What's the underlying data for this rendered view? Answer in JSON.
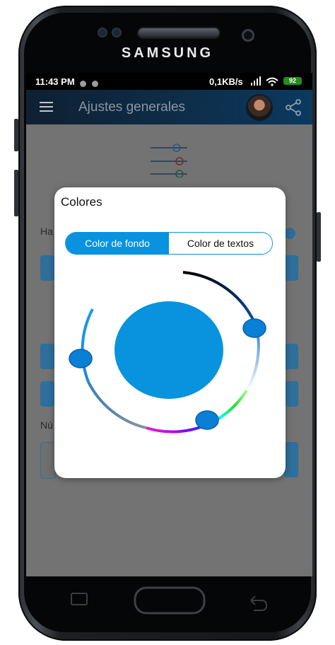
{
  "device": {
    "brand": "SAMSUNG"
  },
  "statusbar": {
    "time": "11:43 PM",
    "network_rate": "0,1KB/s",
    "battery": "92"
  },
  "appbar": {
    "title": "Ajustes generales",
    "menu_icon": "hamburger-menu-icon",
    "share_icon": "share-icon"
  },
  "background": {
    "label_a": "Ha",
    "label_b": "Nú"
  },
  "dialog": {
    "title": "Colores",
    "tabs": [
      {
        "label": "Color de fondo",
        "active": true
      },
      {
        "label": "Color de textos",
        "active": false
      }
    ],
    "selected_color": "#0992de"
  },
  "colors": {
    "accent": "#0992de",
    "appbar": "#0f2032",
    "scrim": "#737373"
  }
}
